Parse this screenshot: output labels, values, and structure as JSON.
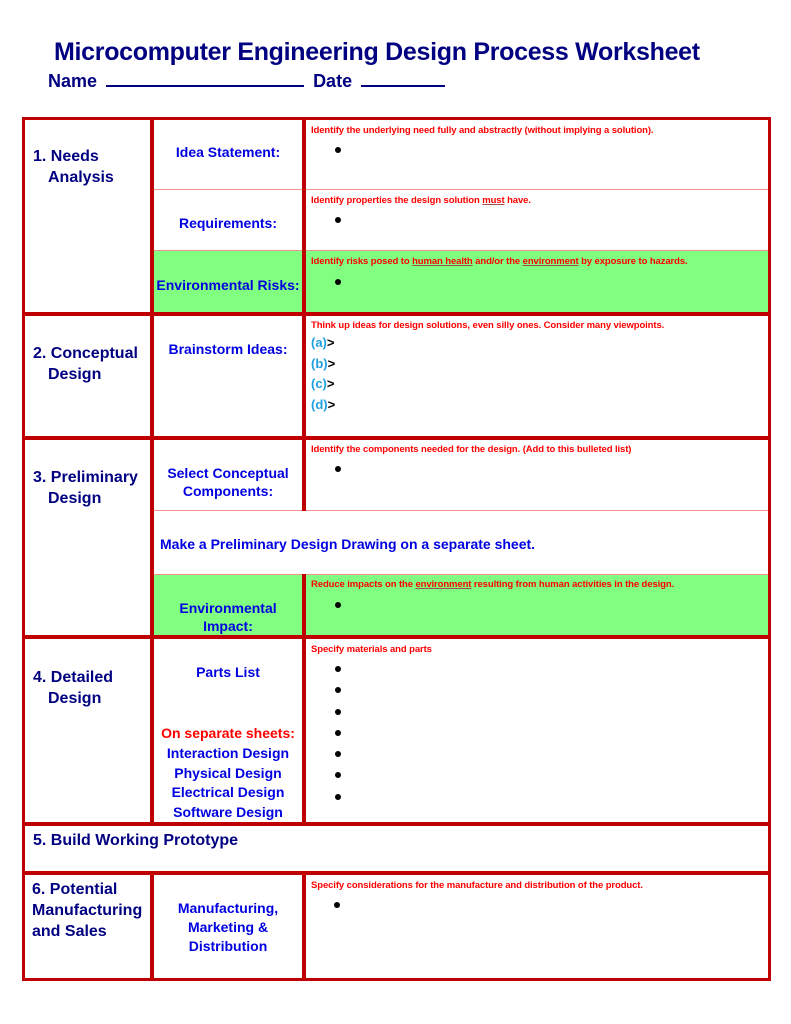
{
  "header": {
    "title": "Microcomputer Engineering Design Process Worksheet",
    "name_label": "Name",
    "date_label": "Date"
  },
  "colors": {
    "border": "#c00000",
    "title_text": "#000080",
    "label_text": "#0000e0",
    "hint_text": "#ff0000",
    "environment_fill": "#80ff80",
    "bullet_letter": "#20a0e0"
  },
  "sections": {
    "needs": {
      "heading": [
        "1. Needs",
        "Analysis"
      ],
      "idea_label": "Idea Statement:",
      "idea_hint": "Identify the underlying need fully and abstractly (without implying a solution).",
      "req_label": "Requirements:",
      "req_hint_pre": "Identify properties the design solution ",
      "req_hint_u": "must",
      "req_hint_post": " have.",
      "risk_label": "Environmental Risks:",
      "risk_hint_1": "Identify risks posed to ",
      "risk_hint_u1": "human health",
      "risk_hint_2": " and/or the ",
      "risk_hint_u2": "environment",
      "risk_hint_3": " by exposure to hazards."
    },
    "conceptual": {
      "heading": [
        "2. Conceptual",
        "Design"
      ],
      "label": "Brainstorm Ideas:",
      "hint": "Think up ideas for design solutions, even silly ones.  Consider many viewpoints.",
      "items": [
        {
          "letter": "(a)",
          "mark": ">"
        },
        {
          "letter": "(b)",
          "mark": ">"
        },
        {
          "letter": "(c)",
          "mark": ">"
        },
        {
          "letter": "(d)",
          "mark": ">"
        }
      ]
    },
    "preliminary": {
      "heading": [
        "3. Preliminary",
        "Design"
      ],
      "components_label": [
        "Select Conceptual",
        "Components:"
      ],
      "components_hint": "Identify the components needed for the design. (Add to this bulleted list)",
      "drawing_note": "Make a Preliminary Design Drawing on a separate sheet.",
      "impact_label": "Environmental Impact:",
      "impact_hint_1": "Reduce impacts on the ",
      "impact_hint_u": "environment",
      "impact_hint_2": " resulting from human activities in the design."
    },
    "detailed": {
      "heading": [
        "4. Detailed",
        "Design"
      ],
      "parts_label": "Parts List",
      "separate_label": "On separate sheets:",
      "sheets": [
        "Interaction Design",
        "Physical Design",
        "Electrical Design",
        "Software Design"
      ],
      "hint": "Specify materials and parts",
      "bullet_count": 7
    },
    "prototype": {
      "heading": "5. Build Working Prototype"
    },
    "manufacturing": {
      "heading": [
        "6. Potential",
        "Manufacturing",
        "and Sales"
      ],
      "label": [
        "Manufacturing,",
        "Marketing &",
        "Distribution"
      ],
      "hint": "Specify considerations for the manufacture and distribution of the product."
    }
  }
}
